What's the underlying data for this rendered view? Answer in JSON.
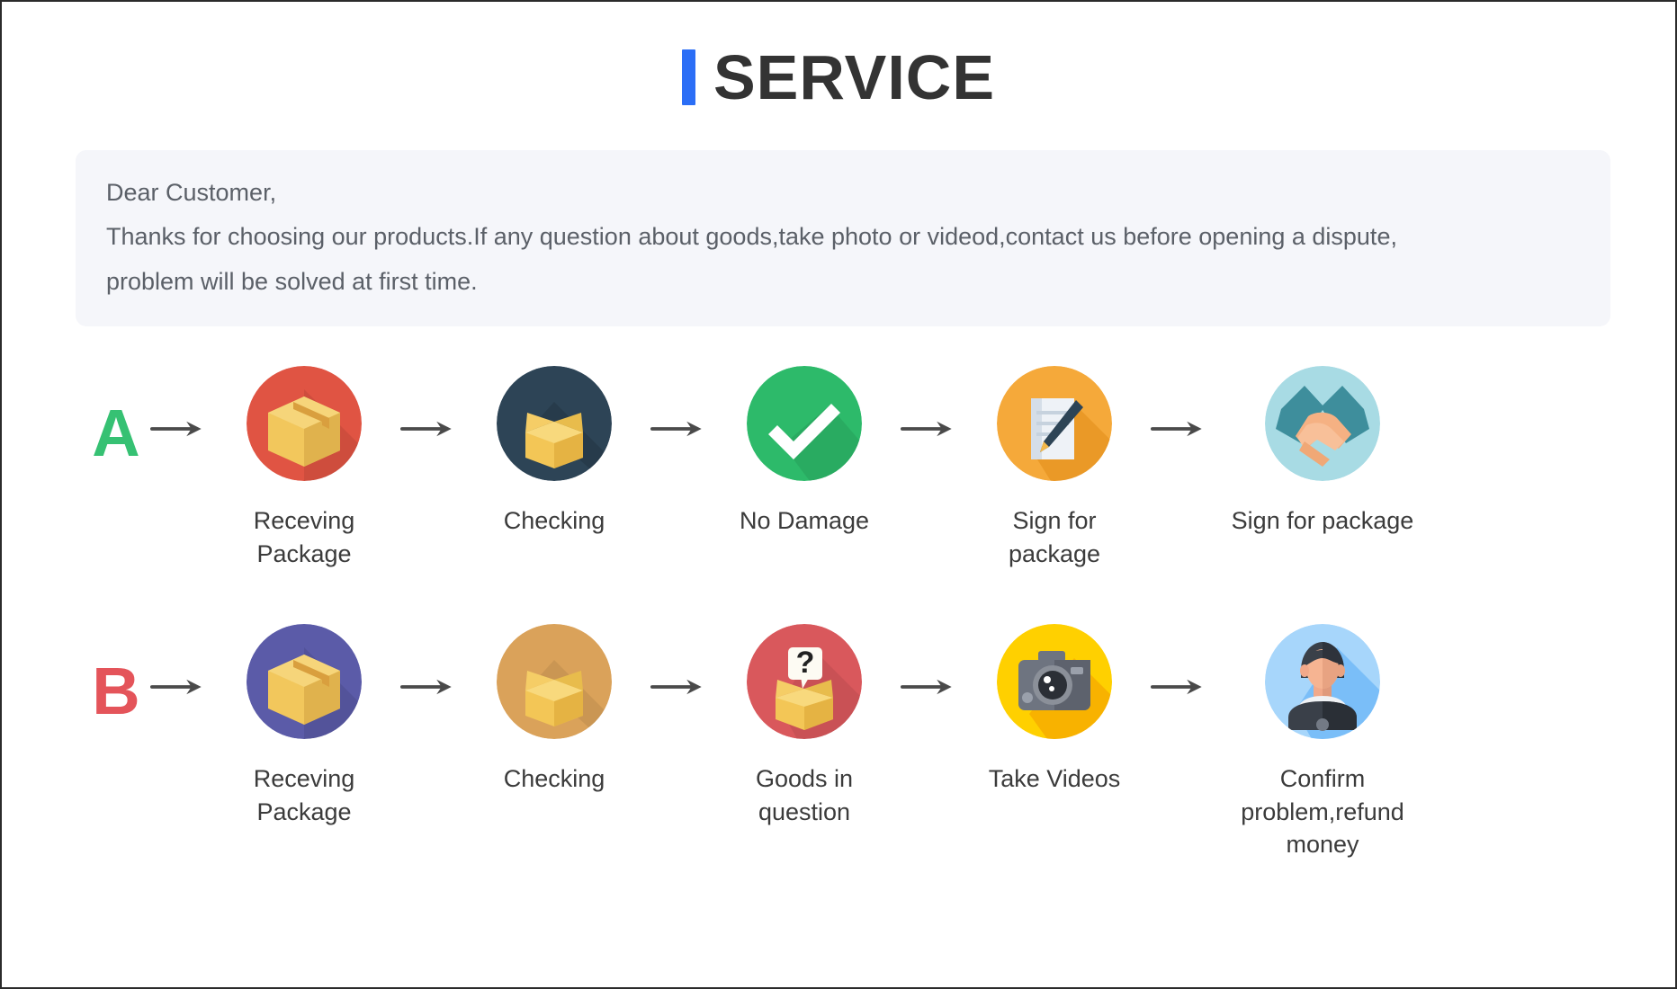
{
  "header": {
    "title": "SERVICE",
    "accent_color": "#2b6ef6"
  },
  "notice": {
    "line1": "Dear Customer,",
    "line2": "Thanks for choosing our products.If any question about goods,take photo or videod,contact us before opening a dispute,",
    "line3": "problem will be solved at first time.",
    "background_color": "#f5f6fa"
  },
  "flows": [
    {
      "letter": "A",
      "letter_color": "#36c173",
      "steps": [
        {
          "label": "Receving Package",
          "icon": "closed-box-icon",
          "circle_color": "#e05443"
        },
        {
          "label": "Checking",
          "icon": "open-box-icon",
          "circle_color": "#2d4456"
        },
        {
          "label": "No Damage",
          "icon": "checkmark-icon",
          "circle_color": "#2dba6a"
        },
        {
          "label": "Sign for package",
          "icon": "document-pen-icon",
          "circle_color": "#f5a93a"
        },
        {
          "label": "Sign for package",
          "icon": "handshake-icon",
          "circle_color": "#a8dbe4"
        }
      ]
    },
    {
      "letter": "B",
      "letter_color": "#e4545a",
      "steps": [
        {
          "label": "Receving Package",
          "icon": "closed-box-icon",
          "circle_color": "#5b5ba8"
        },
        {
          "label": "Checking",
          "icon": "open-box-icon",
          "circle_color": "#daa25a"
        },
        {
          "label": "Goods in question",
          "icon": "question-box-icon",
          "circle_color": "#d9585c"
        },
        {
          "label": "Take Videos",
          "icon": "camera-icon",
          "circle_color": "#ffd000"
        },
        {
          "label": "Confirm problem,refund money",
          "icon": "person-icon",
          "circle_color": "#a7d6fb"
        }
      ]
    }
  ],
  "arrow": {
    "name": "arrow-right-icon",
    "color": "#4a4a4a"
  }
}
